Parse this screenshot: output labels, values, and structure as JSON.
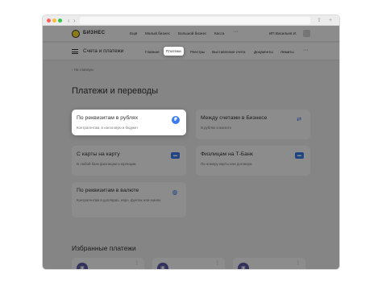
{
  "topnav": {
    "logo_text": "БИЗНЕС",
    "links": [
      "Ещё",
      "Малый бизнес",
      "Большой бизнес",
      "Касса"
    ],
    "more": "···",
    "company": "ИП Васильев И.",
    "avatar_glyph": ""
  },
  "subnav": {
    "section_title": "Счета и платежи",
    "tabs": [
      "Главная",
      "Платежи",
      "Реестры",
      "Выставление счета",
      "Документы",
      "Лимиты"
    ],
    "active_tab": "Платежи",
    "more": "···"
  },
  "breadcrumb": "‹ На главную",
  "page_title": "Платежи и переводы",
  "cards": [
    {
      "title": "По реквизитам в рублях",
      "subtitle": "Контрагентам, в налоговую и бюджет",
      "icon": "ruble-icon",
      "glyph": "₽",
      "highlighted": true
    },
    {
      "title": "Между счетами в Бизнесе",
      "subtitle": "В рублях и валюте",
      "icon": "transfer-arrows-icon",
      "glyph": "⇄",
      "highlighted": false
    },
    {
      "title": "С карты на карту",
      "subtitle": "В любой банк физлицам и юрлицам",
      "icon": "card-icon",
      "glyph": "▬",
      "highlighted": false
    },
    {
      "title": "Физлицам на Т-Банк",
      "subtitle": "По номеру карты или договора",
      "icon": "card-transfer-icon",
      "glyph": "▬",
      "highlighted": false
    },
    {
      "title": "По реквизитам в валюте",
      "subtitle": "Контрагентам в долларах, евро, фунтах или юанях",
      "icon": "globe-icon",
      "glyph": "◍",
      "highlighted": false
    }
  ],
  "favorites": {
    "title": "Избранные платежи",
    "menu": "⋮",
    "avatar_glyph": "▣"
  },
  "browser": {
    "back": "‹",
    "forward": "›",
    "share": "⇧",
    "new_tab": "+"
  },
  "colors": {
    "accent": "#3b7cf0",
    "logo_yellow": "#ffdd2d",
    "favorite_avatar": "#5b5ba8",
    "overlay": "rgba(0,0,0,0.45)"
  }
}
